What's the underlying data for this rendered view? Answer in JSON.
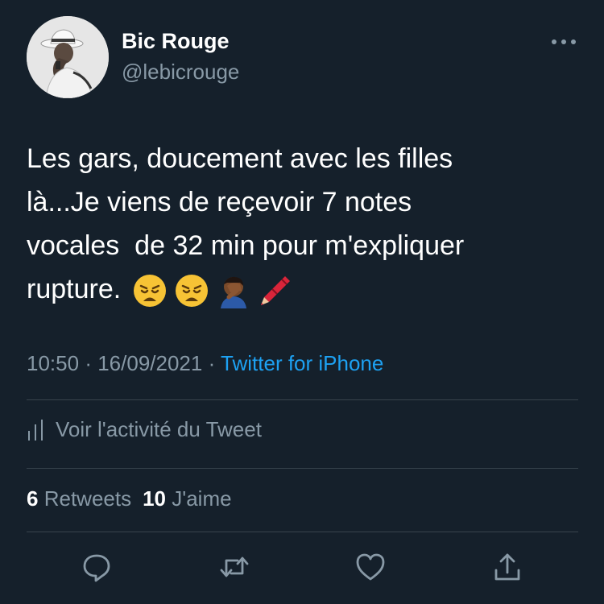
{
  "author": {
    "name": "Bic Rouge",
    "handle": "@lebicrouge"
  },
  "tweet": {
    "text": "Les gars, doucement avec les filles\nlà...Je viens de reçevoir 7 notes\nvocales  de 32 min pour m'expliquer\nrupture.",
    "emojis": [
      "weary-face",
      "weary-face",
      "person-facepalming",
      "crayon"
    ]
  },
  "meta": {
    "time": "10:50",
    "date": "16/09/2021",
    "separator": "·",
    "source": "Twitter for iPhone"
  },
  "activity": {
    "label": "Voir l'activité du Tweet",
    "icon": "bar-chart-icon"
  },
  "stats": {
    "retweets_count": "6",
    "retweets_label": "Retweets",
    "likes_count": "10",
    "likes_label": "J'aime"
  },
  "actions": [
    "reply-icon",
    "retweet-icon",
    "like-icon",
    "share-icon"
  ],
  "colors": {
    "background": "#15202b",
    "text": "#ffffff",
    "secondary": "#8899a6",
    "accent": "#1da1f2",
    "divider": "#38444d"
  }
}
